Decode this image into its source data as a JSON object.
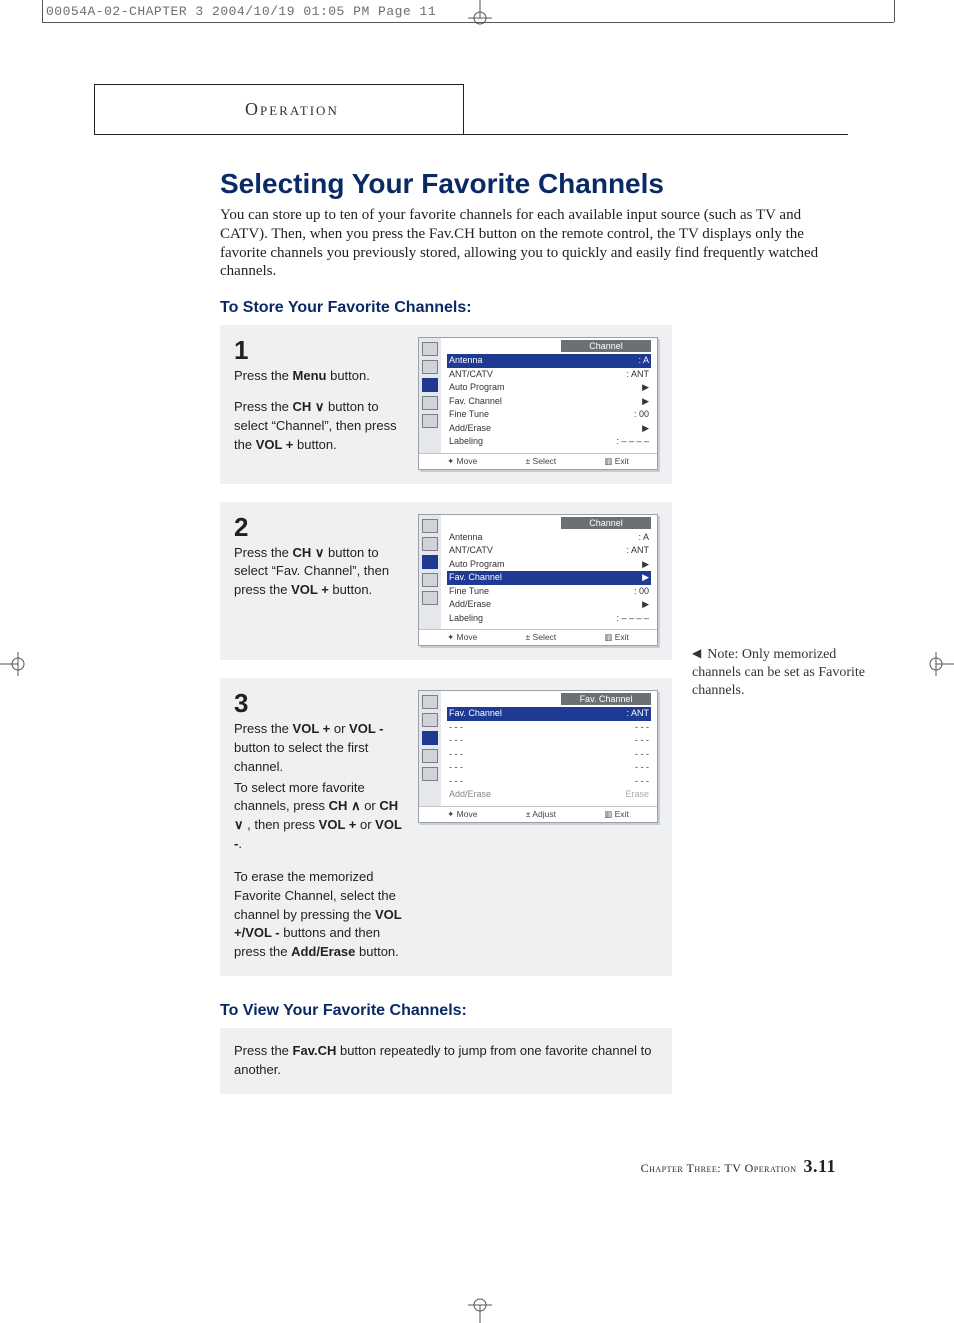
{
  "film_header": "00054A-02-CHAPTER 3  2004/10/19  01:05 PM  Page 11",
  "tab_label": "Operation",
  "title": "Selecting Your Favorite Channels",
  "intro": "You can store up to ten of your favorite channels for each available input source (such as TV and CATV). Then, when you press the Fav.CH button on the remote control, the TV displays only the favorite channels you previously stored, allowing you to quickly and easily find frequently watched channels.",
  "store_heading": "To Store Your Favorite Channels:",
  "view_heading": "To View Your Favorite Channels:",
  "side_note": "Note: Only memorized channels can be set as Favorite channels.",
  "footer": {
    "chapter": "Chapter Three: TV Operation",
    "page": "3.11"
  },
  "steps": {
    "s1": {
      "num": "1",
      "p1a": "Press the ",
      "p1b": "Menu",
      "p1c": " button.",
      "p2a": "Press the ",
      "p2b": "CH ",
      "p2c": " button to select “Channel”, then press the ",
      "p2d": "VOL +",
      "p2e": " button."
    },
    "s2": {
      "num": "2",
      "p1a": "Press the ",
      "p1b": "CH ",
      "p1c": " button to select “Fav. Channel”, then press the ",
      "p1d": "VOL +",
      "p1e": "  button."
    },
    "s3": {
      "num": "3",
      "p1a": "Press the ",
      "p1b": "VOL +",
      "p1c": " or ",
      "p1d": "VOL -",
      "p1e": " button to select the first channel.",
      "p2a": "To select more favorite channels, press  ",
      "p2b": "CH ",
      "p2c": " or ",
      "p2d": "CH ",
      "p2e": " , then press ",
      "p2f": "VOL +",
      "p2g": " or ",
      "p2h": "VOL -",
      "p2i": ".",
      "p3a": "To erase the memorized Favorite Channel, select the channel by pressing the ",
      "p3b": "VOL +/VOL -",
      "p3c": " buttons and then press the ",
      "p3d": "Add/Erase",
      "p3e": " button."
    }
  },
  "view_text": {
    "a": "Press the ",
    "b": "Fav.CH",
    "c": " button repeatedly to jump from one favorite channel to another."
  },
  "osd": {
    "title_channel": "Channel",
    "title_fav": "Fav. Channel",
    "rows": {
      "antenna": {
        "lbl": "Antenna",
        "val": ": A"
      },
      "antcatv": {
        "lbl": "ANT/CATV",
        "val": ": ANT"
      },
      "autoprog": {
        "lbl": "Auto Program",
        "val": "▶"
      },
      "favch": {
        "lbl": "Fav. Channel",
        "val": "▶"
      },
      "finetune": {
        "lbl": "Fine Tune",
        "val": ": 00"
      },
      "adderase": {
        "lbl": "Add/Erase",
        "val": "▶"
      },
      "labeling": {
        "lbl": "Labeling",
        "val": ": – – – –"
      }
    },
    "fav_rows": {
      "header": {
        "lbl": "Fav. Channel",
        "val": ": ANT"
      },
      "d1": {
        "lbl": "- - -",
        "val": "- - -"
      },
      "d2": {
        "lbl": "- - -",
        "val": "- - -"
      },
      "d3": {
        "lbl": "- - -",
        "val": "- - -"
      },
      "d4": {
        "lbl": "- - -",
        "val": "- - -"
      },
      "d5": {
        "lbl": "- - -",
        "val": "- - -"
      },
      "ae": {
        "lbl": "Add/Erase",
        "val": "Erase"
      }
    },
    "footer": {
      "move": "✦ Move",
      "select": "± Select",
      "adjust": "± Adjust",
      "exit": "▥ Exit"
    }
  }
}
